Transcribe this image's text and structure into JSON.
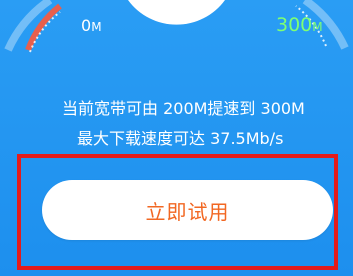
{
  "gauge": {
    "min_value": "0",
    "min_unit": "M",
    "max_value": "300",
    "max_unit": "M",
    "min_color": "#ffffff",
    "max_color": "#7dff74"
  },
  "info": {
    "line1": "当前宽带可由 200M提速到 300M",
    "line2": "最大下载速度可达 37.5Mb/s"
  },
  "cta": {
    "label": "立即试用",
    "text_color": "#f26722"
  },
  "colors": {
    "background": "#2196f1",
    "highlight_frame": "#e41b1b"
  }
}
